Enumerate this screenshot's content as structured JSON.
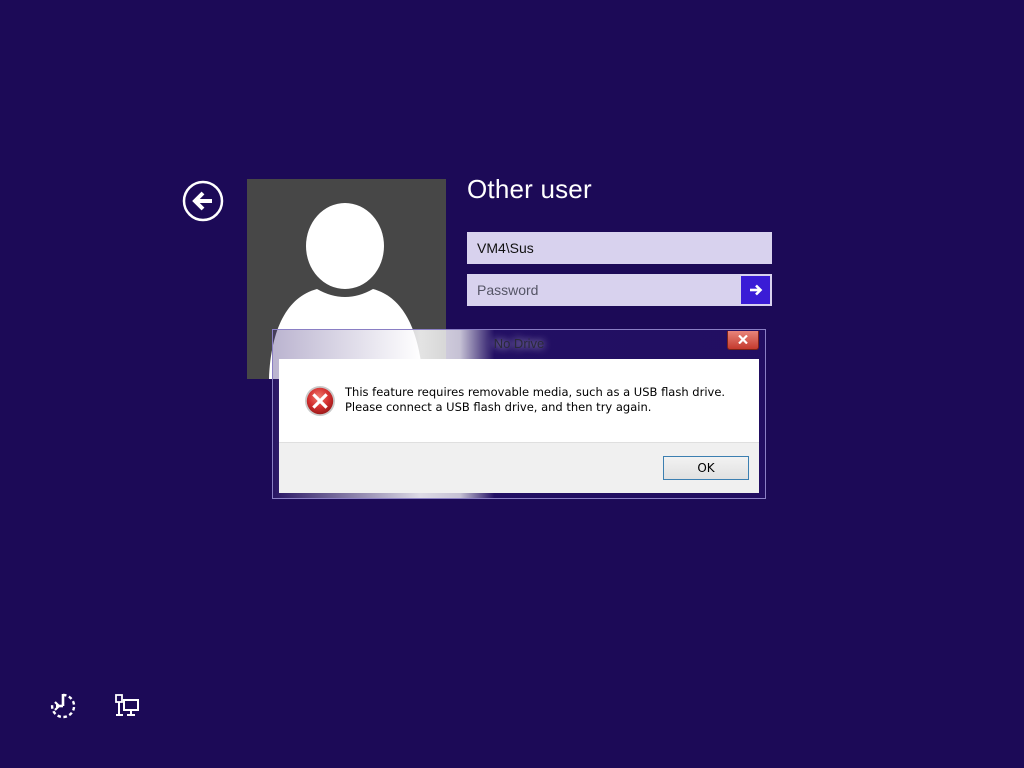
{
  "login": {
    "title": "Other user",
    "username_value": "VM4\\Sus",
    "password_placeholder": "Password",
    "back_icon": "back-arrow-icon",
    "submit_icon": "arrow-right-icon",
    "avatar_icon": "user-silhouette-icon"
  },
  "dialog": {
    "title": "No Drive",
    "message": "This feature requires removable media, such as a USB flash drive. Please connect a USB flash drive, and then try again.",
    "ok_label": "OK",
    "icon": "error-icon",
    "close_icon": "close-icon"
  },
  "bottom_bar": {
    "ease_of_access_icon": "ease-of-access-icon",
    "network_icon": "network-icon"
  },
  "colors": {
    "background": "#1c0a57",
    "field": "#d8d2ee",
    "submit": "#3a1cd6",
    "tile": "#474747",
    "error": "#c62828"
  }
}
